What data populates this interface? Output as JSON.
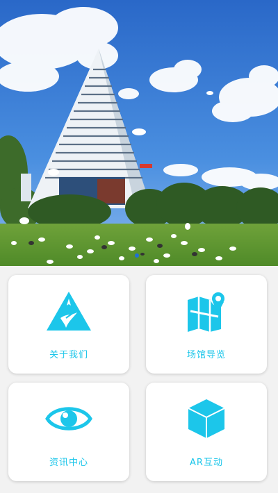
{
  "cards": [
    {
      "label": "关于我们",
      "icon": "triangle-building-icon"
    },
    {
      "label": "场馆导览",
      "icon": "map-pin-icon"
    },
    {
      "label": "资讯中心",
      "icon": "eye-icon"
    },
    {
      "label": "AR互动",
      "icon": "cube-icon"
    }
  ],
  "colors": {
    "accent": "#1cc6ea",
    "background": "#f2f2f2",
    "card": "#ffffff"
  }
}
